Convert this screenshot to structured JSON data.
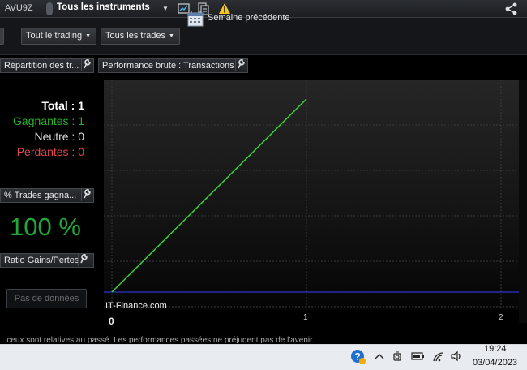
{
  "topbar": {
    "account": "AVU9Z",
    "instruments_label": "Tous les instruments"
  },
  "toolbar": {
    "trading_dropdown": "Tout le trading",
    "trades_dropdown": "Tous les trades",
    "period_label": "Semaine précédente"
  },
  "panels": {
    "distribution_title": "Répartition des tr...",
    "performance_title": "Performance brute : Transactions",
    "pct_title": "% Trades gagna...",
    "ratio_title": "Ratio Gains/Pertes"
  },
  "stats": {
    "total": "Total : 1",
    "winning": "Gagnantes : 1",
    "neutral": "Neutre : 0",
    "losing": "Perdantes : 0"
  },
  "pct_value": "100 %",
  "no_data_button": "Pas de données",
  "chart": {
    "watermark": "IT-Finance.com",
    "x_ticks": [
      "0",
      "1",
      "2"
    ]
  },
  "chart_data": {
    "type": "line",
    "x": [
      0,
      1
    ],
    "series": [
      {
        "values": [
          0,
          1
        ],
        "color": "#3ad13a"
      }
    ],
    "xlim": [
      0,
      2
    ],
    "grid": true
  },
  "disclaimer": "...ceux sont relatives au passé. Les performances passées ne préjugent pas de l'avenir.",
  "taskbar": {
    "time": "19:24",
    "date": "03/04/2023"
  },
  "colors": {
    "winning": "#28b32b",
    "losing": "#e04a4a",
    "chart_line": "#3ad13a",
    "baseline": "#3b3bff"
  }
}
